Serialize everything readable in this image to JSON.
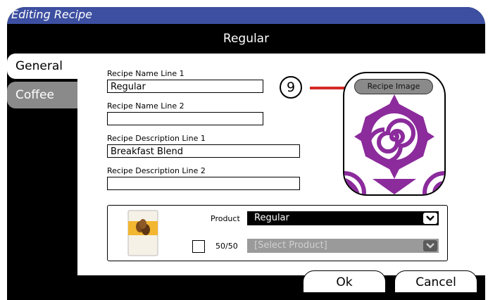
{
  "window": {
    "title": "Editing Recipe"
  },
  "header": {
    "recipe_name": "Regular"
  },
  "tabs": [
    {
      "label": "General"
    },
    {
      "label": "Coffee"
    }
  ],
  "form": {
    "name1": {
      "label": "Recipe Name Line 1",
      "value": "Regular"
    },
    "name2": {
      "label": "Recipe Name Line 2",
      "value": ""
    },
    "desc1": {
      "label": "Recipe Description Line 1",
      "value": "Breakfast Blend"
    },
    "desc2": {
      "label": "Recipe Description Line 2",
      "value": ""
    }
  },
  "callout": {
    "number": "9",
    "arrow_color": "#d42a25"
  },
  "recipe_image": {
    "button_label": "Recipe Image",
    "accent_color": "#8b2b9c"
  },
  "product": {
    "label": "Product",
    "selected": "Regular",
    "fifty_label": "50/50",
    "fifty_placeholder": "[Select Product]"
  },
  "actions": {
    "ok": "Ok",
    "cancel": "Cancel"
  },
  "colors": {
    "title_bar": "#3c4fa0",
    "inactive_tab": "#8a8a8a"
  }
}
